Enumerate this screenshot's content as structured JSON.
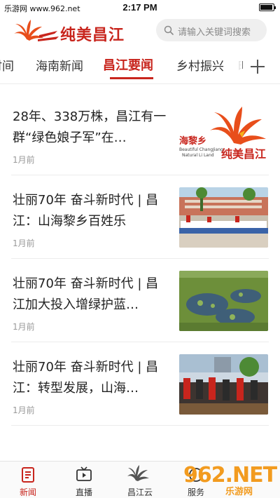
{
  "status_bar": {
    "carrier": "乐游网 www.962.net",
    "time": "2:17 PM"
  },
  "header": {
    "logo_text": "纯美昌江",
    "search_placeholder": "请输入关键词搜索"
  },
  "tabs": [
    {
      "label": "时间"
    },
    {
      "label": "海南新闻"
    },
    {
      "label": "昌江要闻",
      "active": true
    },
    {
      "label": "乡村振兴"
    },
    {
      "label": "时"
    }
  ],
  "news": [
    {
      "title": "28年、338万株，昌江有一群“绿色娘子军”在…",
      "time": "1月前",
      "thumb_text_1": "海黎乡",
      "thumb_text_2": "纯美昌江",
      "thumb_text_3": "Beautiful ChangJiang",
      "thumb_text_4": "Natural Li Land"
    },
    {
      "title": "壮丽70年 奋斗新时代 | 昌江：山海黎乡百姓乐",
      "time": "1月前"
    },
    {
      "title": "壮丽70年 奋斗新时代 | 昌江加大投入增绿护蓝…",
      "time": "1月前"
    },
    {
      "title": "壮丽70年 奋斗新时代 | 昌江：转型发展，山海…",
      "time": "1月前"
    }
  ],
  "bottom_nav": [
    {
      "label": "新闻",
      "icon": "news-icon",
      "active": true
    },
    {
      "label": "直播",
      "icon": "tv-icon"
    },
    {
      "label": "昌江云",
      "icon": "flower-logo-icon"
    },
    {
      "label": "服务",
      "icon": "service-icon"
    }
  ],
  "watermark": {
    "big": "962.NET",
    "small": "乐游网"
  },
  "colors": {
    "accent": "#c8251d",
    "thumb_green": "#6d8f3a",
    "watermark": "#f29b1f"
  }
}
